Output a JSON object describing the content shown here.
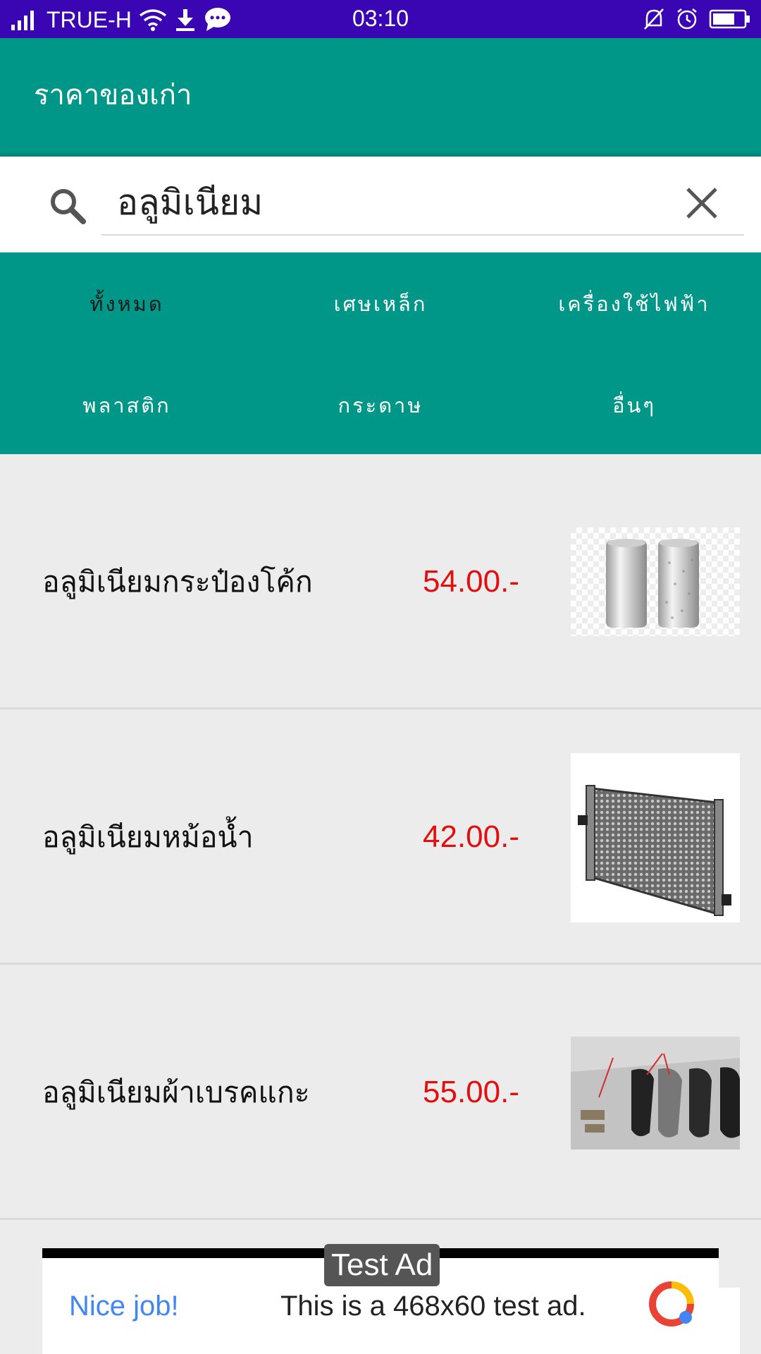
{
  "status_bar": {
    "carrier": "TRUE-H",
    "time": "03:10",
    "icons": [
      "signal-icon",
      "wifi-icon",
      "download-icon",
      "message-icon",
      "mute-icon",
      "alarm-icon",
      "battery-icon"
    ]
  },
  "app_bar": {
    "title": "ราคาของเก่า",
    "color": "#009688"
  },
  "search": {
    "value": "อลูมิเนียม",
    "icons": [
      "search-icon",
      "close-icon"
    ]
  },
  "categories": [
    {
      "label": "ทั้งหมด",
      "active": true
    },
    {
      "label": "เศษเหล็ก",
      "active": false
    },
    {
      "label": "เครื่องใช้ไฟฟ้า",
      "active": false
    },
    {
      "label": "พลาสติก",
      "active": false
    },
    {
      "label": "กระดาษ",
      "active": false
    },
    {
      "label": "อื่นๆ",
      "active": false
    }
  ],
  "items": [
    {
      "name": "อลูมิเนียมกระป๋องโค้ก",
      "price": "54.00.-",
      "image": "aluminum-cans"
    },
    {
      "name": "อลูมิเนียมหม้อน้ำ",
      "price": "42.00.-",
      "image": "radiator"
    },
    {
      "name": "อลูมิเนียมผ้าเบรคแกะ",
      "price": "55.00.-",
      "image": "brake-pads"
    }
  ],
  "ad": {
    "label": "Test Ad",
    "nice": "Nice job!",
    "text": "This is a 468x60 test ad."
  },
  "colors": {
    "status_bar": "#3a06b4",
    "accent": "#009688",
    "price": "#e30f0f"
  }
}
